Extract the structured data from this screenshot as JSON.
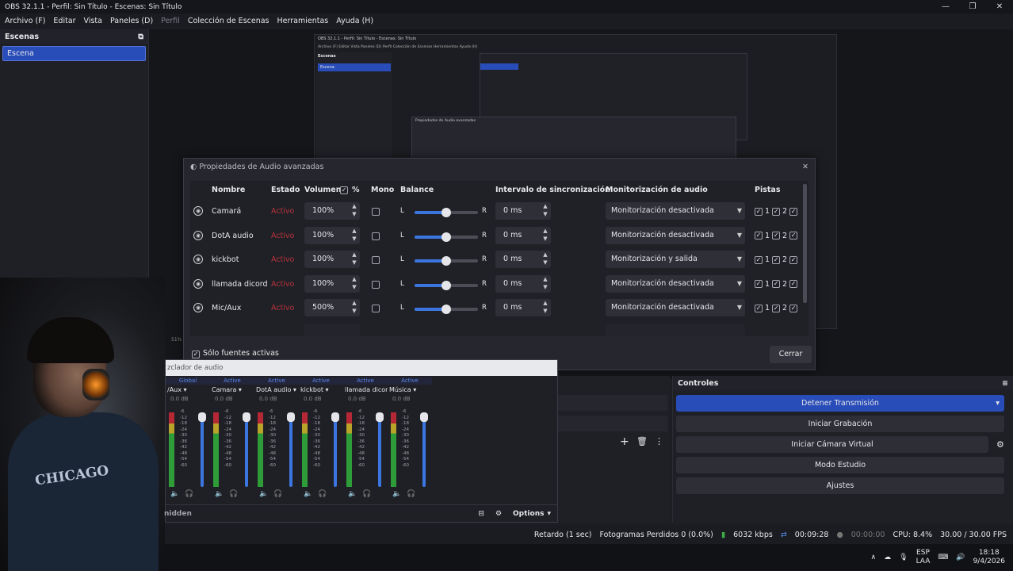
{
  "window": {
    "title": "OBS 32.1.1 - Perfil: Sin Título - Escenas: Sin Título",
    "controls": [
      "—",
      "❐",
      "✕"
    ]
  },
  "menu": [
    "Archivo (F)",
    "Editar",
    "Vista",
    "Paneles (D)",
    "Perfil",
    "Colección de Escenas",
    "Herramientas",
    "Ayuda (H)"
  ],
  "scenes": {
    "header": "Escenas",
    "items": [
      "Escena"
    ]
  },
  "nested": {
    "title": "OBS 32.1.1 - Perfil: Sin Título - Escenas: Sin Título",
    "menu": "Archivo (F)   Editar   Vista   Paneles (D)   Perfil   Colección de Escenas   Herramientas   Ayuda (H)",
    "scenes_header": "Escenas",
    "scene": "Escena",
    "dialog_text": "Propiedades de Audio avanzadas"
  },
  "advanced_audio": {
    "title": "Propiedades de Audio avanzadas",
    "headers": {
      "name": "Nombre",
      "status": "Estado",
      "volume": "Volumen",
      "percent": "%",
      "mono": "Mono",
      "balance": "Balance",
      "sync": "Intervalo de sincronización",
      "monitoring": "Monitorización de audio",
      "tracks": "Pistas"
    },
    "rows": [
      {
        "name": "Camará",
        "status": "Activo",
        "volume": "100%",
        "balance": 0.5,
        "sync": "0 ms",
        "monitoring": "Monitorización desactivada",
        "tracks": [
          "1",
          "2"
        ]
      },
      {
        "name": "DotA audio",
        "status": "Activo",
        "volume": "100%",
        "balance": 0.5,
        "sync": "0 ms",
        "monitoring": "Monitorización desactivada",
        "tracks": [
          "1",
          "2"
        ]
      },
      {
        "name": "kickbot",
        "status": "Activo",
        "volume": "100%",
        "balance": 0.5,
        "sync": "0 ms",
        "monitoring": "Monitorización y salida",
        "tracks": [
          "1",
          "2"
        ]
      },
      {
        "name": "llamada dicord",
        "status": "Activo",
        "volume": "100%",
        "balance": 0.5,
        "sync": "0 ms",
        "monitoring": "Monitorización desactivada",
        "tracks": [
          "1",
          "2"
        ]
      },
      {
        "name": "Mic/Aux",
        "status": "Activo",
        "volume": "500%",
        "balance": 0.5,
        "sync": "0 ms",
        "monitoring": "Monitorización desactivada",
        "tracks": [
          "1",
          "2"
        ]
      }
    ],
    "balance_left": "L",
    "balance_right": "R",
    "only_active": "Sólo fuentes activas",
    "close": "Cerrar"
  },
  "mixer": {
    "title": "zclador de audio",
    "channels": [
      {
        "tag": "Global",
        "name": "/Aux",
        "db": "0.0 dB"
      },
      {
        "tag": "Active",
        "name": "Camara",
        "db": "0.0 dB"
      },
      {
        "tag": "Active",
        "name": "DotA audio",
        "db": "0.0 dB"
      },
      {
        "tag": "Active",
        "name": "kickbot",
        "db": "0.0 dB"
      },
      {
        "tag": "Active",
        "name": "llamada dicord",
        "db": "0.0 dB"
      },
      {
        "tag": "Active",
        "name": "Música",
        "db": "0.0 dB"
      }
    ],
    "scale": [
      "-6",
      "-12",
      "-18",
      "-24",
      "-30",
      "-36",
      "-42",
      "-48",
      "-54",
      "-60"
    ],
    "hidden": "nidden",
    "options": "Options"
  },
  "controls": {
    "header": "Controles",
    "buttons": [
      "Detener Transmisión",
      "Iniciar Grabación",
      "Iniciar Cámara Virtual",
      "Modo Estudio",
      "Ajustes"
    ]
  },
  "status": {
    "delay": "Retardo (1 sec)",
    "dropped": "Fotogramas Perdidos 0 (0.0%)",
    "kbps": "6032 kbps",
    "stream_time": "00:09:28",
    "rec_time": "00:00:00",
    "cpu": "CPU: 8.4%",
    "fps": "30.00 / 30.00 FPS"
  },
  "taskbar": {
    "lang1": "ESP",
    "lang2": "LAA",
    "time": "18:18",
    "date": "9/4/2026"
  },
  "facecam": {
    "shirt": "CHICAGO"
  },
  "zoom_hint": "51%"
}
